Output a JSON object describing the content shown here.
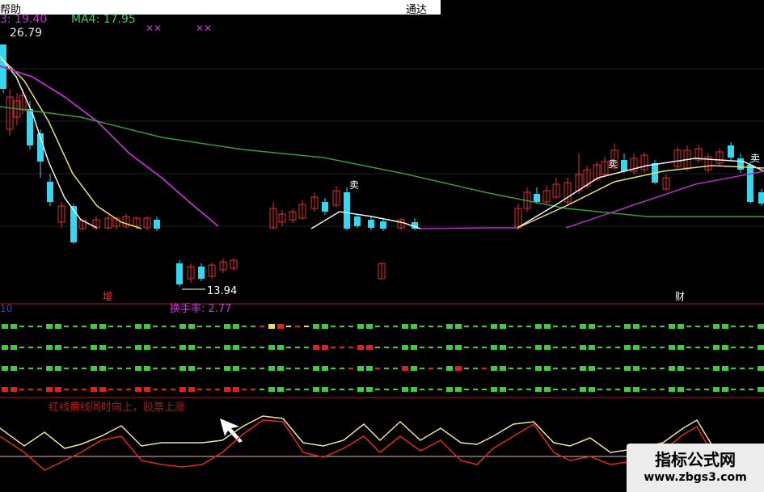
{
  "menu": {
    "left_label": "帮助",
    "right_label": "通达"
  },
  "price_panel": {
    "ma3_text": "3: 19.40",
    "ma4_text": "MA4: 17.95",
    "high_text": "26.79",
    "low_text": "13.94",
    "sell_label_1": "卖",
    "sell_label_2": "卖",
    "sell_label_3": "卖",
    "marker_left": "增",
    "marker_right": "财"
  },
  "turnover_panel": {
    "left_value": "10",
    "title": "换手率: 2.77"
  },
  "oscillator_panel": {
    "annotation": "红线黄线同时向上，股票上涨"
  },
  "watermark": {
    "title": "指标公式网",
    "url": "www.zbgs3.com"
  },
  "colors": {
    "background": "#000000",
    "candle_up": "#e0302f",
    "candle_down": "#35d6f0",
    "ma_white": "#f2f2f2",
    "ma_yellow": "#e8e070",
    "ma_purple": "#b22fc0",
    "ma_green": "#3a9a3a",
    "bar_green": "#3ecb3e",
    "bar_red": "#e02020",
    "bar_yellow": "#f0e040",
    "osc_red": "#e02a20",
    "osc_yellow": "#efe3a0",
    "panel_divider": "#b01818"
  }
}
